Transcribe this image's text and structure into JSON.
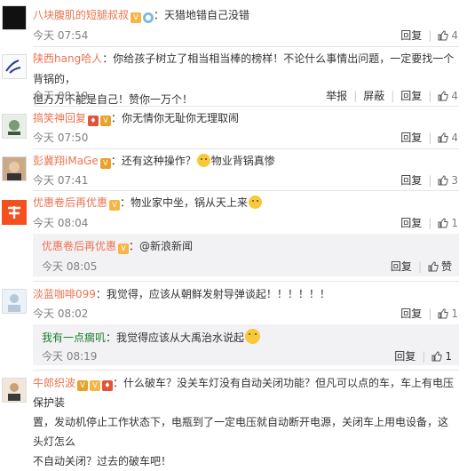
{
  "comments": [
    {
      "name": "八块腹肌的短腿叔叔",
      "text": "：天猎地错自己没错",
      "time": "今天 07:54",
      "reply": "回复",
      "likes": "4"
    },
    {
      "name": "陕西hang哈人",
      "text": "：你给孩子树立了相当相当棒的榜样！不论什么事情出问题，一定要找一个背锅的，",
      "text2": "但万万不能是自己！赞你一万个！",
      "time": "今天 08:19",
      "report": "举报",
      "block": "屏蔽",
      "reply": "回复",
      "likes": "4"
    },
    {
      "name": "搞笑神回复",
      "text": "：你无情你无耻你无理取闹",
      "time": "今天 07:50",
      "reply": "回复",
      "likes": "4"
    },
    {
      "name": "彭冀翔iMaGe",
      "text": "：还有这种操作？",
      "text_after": "物业背锅真惨",
      "time": "今天 07:41",
      "reply": "回复",
      "likes": "3"
    },
    {
      "name": "优惠卷后再优惠",
      "text": "：物业家中坐，锅从天上来",
      "time": "今天 08:04",
      "reply": "回复",
      "likes": "1"
    },
    {
      "name": "淡蓝咖啡099",
      "text": "：我觉得，应该从朝鲜发射导弹谈起！！！！！！",
      "time": "今天 08:02",
      "reply": "回复",
      "likes": "1"
    },
    {
      "name": "牛郎织波",
      "text": "：什么破车？没关车灯没有自动关闭功能？但凡可以点的车，车上有电压保护装",
      "text2": "置，发动机停止工作状态下，电瓶到了一定电压就自动断开电源，关闭车上用电设备，这头灯怎么",
      "text3": "不自动关闭？过去的破车吧！"
    }
  ],
  "replies": [
    {
      "name": "优惠卷后再优惠",
      "text": "：@新浪新闻",
      "time": "今天 08:05",
      "reply": "回复",
      "like_label": "赞"
    },
    {
      "name": "我有一点瘸叽",
      "text": "：我觉得应该从大禹治水说起",
      "time": "今天 08:19",
      "reply": "回复",
      "likes": "1"
    }
  ],
  "colors": {
    "accent": "#eb7350",
    "name_green": "#1d7d2c",
    "meta": "#808080"
  }
}
